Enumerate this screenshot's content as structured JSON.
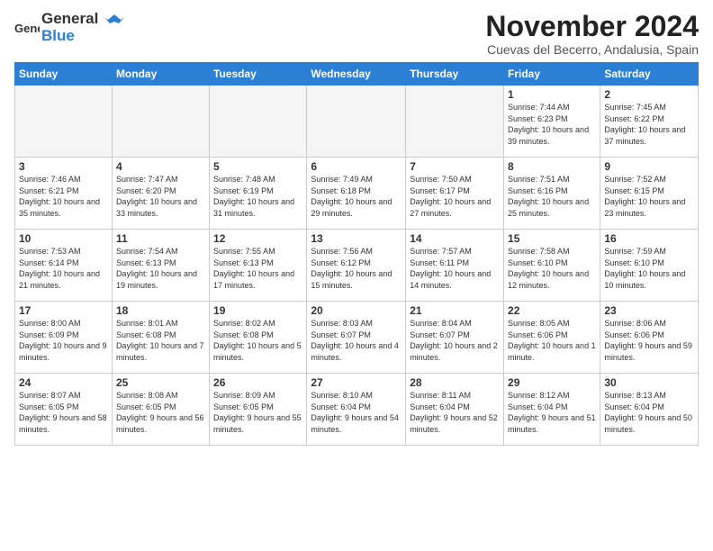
{
  "header": {
    "logo_general": "General",
    "logo_blue": "Blue",
    "month_title": "November 2024",
    "location": "Cuevas del Becerro, Andalusia, Spain"
  },
  "weekdays": [
    "Sunday",
    "Monday",
    "Tuesday",
    "Wednesday",
    "Thursday",
    "Friday",
    "Saturday"
  ],
  "weeks": [
    [
      {
        "day": "",
        "info": ""
      },
      {
        "day": "",
        "info": ""
      },
      {
        "day": "",
        "info": ""
      },
      {
        "day": "",
        "info": ""
      },
      {
        "day": "",
        "info": ""
      },
      {
        "day": "1",
        "info": "Sunrise: 7:44 AM\nSunset: 6:23 PM\nDaylight: 10 hours and 39 minutes."
      },
      {
        "day": "2",
        "info": "Sunrise: 7:45 AM\nSunset: 6:22 PM\nDaylight: 10 hours and 37 minutes."
      }
    ],
    [
      {
        "day": "3",
        "info": "Sunrise: 7:46 AM\nSunset: 6:21 PM\nDaylight: 10 hours and 35 minutes."
      },
      {
        "day": "4",
        "info": "Sunrise: 7:47 AM\nSunset: 6:20 PM\nDaylight: 10 hours and 33 minutes."
      },
      {
        "day": "5",
        "info": "Sunrise: 7:48 AM\nSunset: 6:19 PM\nDaylight: 10 hours and 31 minutes."
      },
      {
        "day": "6",
        "info": "Sunrise: 7:49 AM\nSunset: 6:18 PM\nDaylight: 10 hours and 29 minutes."
      },
      {
        "day": "7",
        "info": "Sunrise: 7:50 AM\nSunset: 6:17 PM\nDaylight: 10 hours and 27 minutes."
      },
      {
        "day": "8",
        "info": "Sunrise: 7:51 AM\nSunset: 6:16 PM\nDaylight: 10 hours and 25 minutes."
      },
      {
        "day": "9",
        "info": "Sunrise: 7:52 AM\nSunset: 6:15 PM\nDaylight: 10 hours and 23 minutes."
      }
    ],
    [
      {
        "day": "10",
        "info": "Sunrise: 7:53 AM\nSunset: 6:14 PM\nDaylight: 10 hours and 21 minutes."
      },
      {
        "day": "11",
        "info": "Sunrise: 7:54 AM\nSunset: 6:13 PM\nDaylight: 10 hours and 19 minutes."
      },
      {
        "day": "12",
        "info": "Sunrise: 7:55 AM\nSunset: 6:13 PM\nDaylight: 10 hours and 17 minutes."
      },
      {
        "day": "13",
        "info": "Sunrise: 7:56 AM\nSunset: 6:12 PM\nDaylight: 10 hours and 15 minutes."
      },
      {
        "day": "14",
        "info": "Sunrise: 7:57 AM\nSunset: 6:11 PM\nDaylight: 10 hours and 14 minutes."
      },
      {
        "day": "15",
        "info": "Sunrise: 7:58 AM\nSunset: 6:10 PM\nDaylight: 10 hours and 12 minutes."
      },
      {
        "day": "16",
        "info": "Sunrise: 7:59 AM\nSunset: 6:10 PM\nDaylight: 10 hours and 10 minutes."
      }
    ],
    [
      {
        "day": "17",
        "info": "Sunrise: 8:00 AM\nSunset: 6:09 PM\nDaylight: 10 hours and 9 minutes."
      },
      {
        "day": "18",
        "info": "Sunrise: 8:01 AM\nSunset: 6:08 PM\nDaylight: 10 hours and 7 minutes."
      },
      {
        "day": "19",
        "info": "Sunrise: 8:02 AM\nSunset: 6:08 PM\nDaylight: 10 hours and 5 minutes."
      },
      {
        "day": "20",
        "info": "Sunrise: 8:03 AM\nSunset: 6:07 PM\nDaylight: 10 hours and 4 minutes."
      },
      {
        "day": "21",
        "info": "Sunrise: 8:04 AM\nSunset: 6:07 PM\nDaylight: 10 hours and 2 minutes."
      },
      {
        "day": "22",
        "info": "Sunrise: 8:05 AM\nSunset: 6:06 PM\nDaylight: 10 hours and 1 minute."
      },
      {
        "day": "23",
        "info": "Sunrise: 8:06 AM\nSunset: 6:06 PM\nDaylight: 9 hours and 59 minutes."
      }
    ],
    [
      {
        "day": "24",
        "info": "Sunrise: 8:07 AM\nSunset: 6:05 PM\nDaylight: 9 hours and 58 minutes."
      },
      {
        "day": "25",
        "info": "Sunrise: 8:08 AM\nSunset: 6:05 PM\nDaylight: 9 hours and 56 minutes."
      },
      {
        "day": "26",
        "info": "Sunrise: 8:09 AM\nSunset: 6:05 PM\nDaylight: 9 hours and 55 minutes."
      },
      {
        "day": "27",
        "info": "Sunrise: 8:10 AM\nSunset: 6:04 PM\nDaylight: 9 hours and 54 minutes."
      },
      {
        "day": "28",
        "info": "Sunrise: 8:11 AM\nSunset: 6:04 PM\nDaylight: 9 hours and 52 minutes."
      },
      {
        "day": "29",
        "info": "Sunrise: 8:12 AM\nSunset: 6:04 PM\nDaylight: 9 hours and 51 minutes."
      },
      {
        "day": "30",
        "info": "Sunrise: 8:13 AM\nSunset: 6:04 PM\nDaylight: 9 hours and 50 minutes."
      }
    ]
  ]
}
